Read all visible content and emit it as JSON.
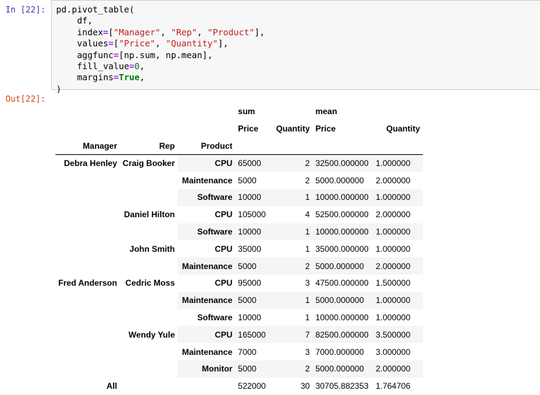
{
  "input_prompt": "In [22]:",
  "output_prompt": "Out[22]:",
  "code": {
    "line1": "pd.pivot_table(",
    "line2": "    df,",
    "line3": {
      "a": "    index",
      "eq": "=",
      "b": "[",
      "s1": "\"Manager\"",
      "c1": ", ",
      "s2": "\"Rep\"",
      "c2": ", ",
      "s3": "\"Product\"",
      "end": "],"
    },
    "line4": {
      "a": "    values",
      "eq": "=",
      "b": "[",
      "s1": "\"Price\"",
      "c1": ", ",
      "s2": "\"Quantity\"",
      "end": "],"
    },
    "line5": {
      "a": "    aggfunc",
      "eq": "=",
      "rest": "[np.sum, np.mean],"
    },
    "line6": {
      "a": "    fill_value",
      "eq": "=",
      "num": "0",
      "end": ","
    },
    "line7": {
      "a": "    margins",
      "eq": "=",
      "kw": "True",
      "end": ","
    },
    "line8": ")"
  },
  "table": {
    "top_headers": [
      "sum",
      "mean"
    ],
    "sub_headers": [
      "Price",
      "Quantity",
      "Price",
      "Quantity"
    ],
    "index_names": [
      "Manager",
      "Rep",
      "Product"
    ],
    "rows": [
      {
        "manager": "Debra Henley",
        "rep": "Craig Booker",
        "product": "CPU",
        "vals": [
          "65000",
          "2",
          "32500.000000",
          "1.000000"
        ]
      },
      {
        "manager": "",
        "rep": "",
        "product": "Maintenance",
        "vals": [
          "5000",
          "2",
          "5000.000000",
          "2.000000"
        ]
      },
      {
        "manager": "",
        "rep": "",
        "product": "Software",
        "vals": [
          "10000",
          "1",
          "10000.000000",
          "1.000000"
        ]
      },
      {
        "manager": "",
        "rep": "Daniel Hilton",
        "product": "CPU",
        "vals": [
          "105000",
          "4",
          "52500.000000",
          "2.000000"
        ]
      },
      {
        "manager": "",
        "rep": "",
        "product": "Software",
        "vals": [
          "10000",
          "1",
          "10000.000000",
          "1.000000"
        ]
      },
      {
        "manager": "",
        "rep": "John Smith",
        "product": "CPU",
        "vals": [
          "35000",
          "1",
          "35000.000000",
          "1.000000"
        ]
      },
      {
        "manager": "",
        "rep": "",
        "product": "Maintenance",
        "vals": [
          "5000",
          "2",
          "5000.000000",
          "2.000000"
        ]
      },
      {
        "manager": "Fred Anderson",
        "rep": "Cedric Moss",
        "product": "CPU",
        "vals": [
          "95000",
          "3",
          "47500.000000",
          "1.500000"
        ]
      },
      {
        "manager": "",
        "rep": "",
        "product": "Maintenance",
        "vals": [
          "5000",
          "1",
          "5000.000000",
          "1.000000"
        ]
      },
      {
        "manager": "",
        "rep": "",
        "product": "Software",
        "vals": [
          "10000",
          "1",
          "10000.000000",
          "1.000000"
        ]
      },
      {
        "manager": "",
        "rep": "Wendy Yule",
        "product": "CPU",
        "vals": [
          "165000",
          "7",
          "82500.000000",
          "3.500000"
        ]
      },
      {
        "manager": "",
        "rep": "",
        "product": "Maintenance",
        "vals": [
          "7000",
          "3",
          "7000.000000",
          "3.000000"
        ]
      },
      {
        "manager": "",
        "rep": "",
        "product": "Monitor",
        "vals": [
          "5000",
          "2",
          "5000.000000",
          "2.000000"
        ]
      },
      {
        "manager": "All",
        "rep": "",
        "product": "",
        "vals": [
          "522000",
          "30",
          "30705.882353",
          "1.764706"
        ]
      }
    ]
  }
}
